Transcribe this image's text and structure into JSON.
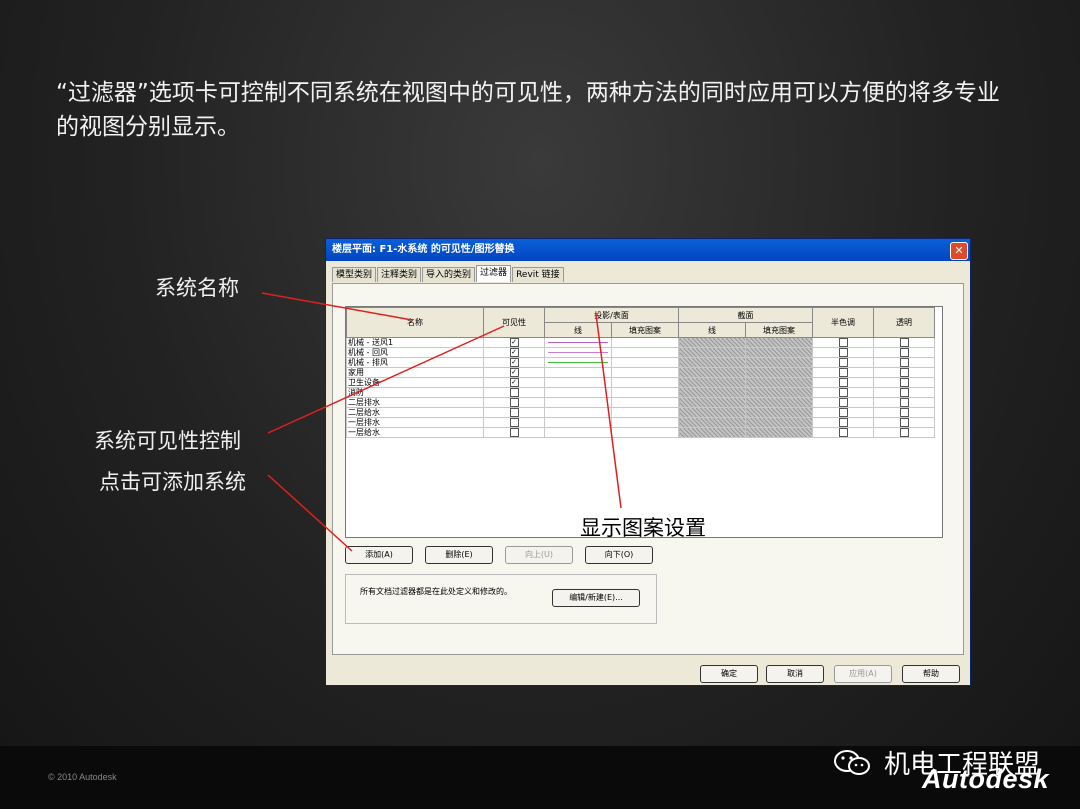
{
  "heading": "“过滤器”选项卡可控制不同系统在视图中的可见性，两种方法的同时应用可以方便的将多专业的视图分别显示。",
  "callouts": {
    "system_name": "系统名称",
    "visibility_control": "系统可见性控制",
    "add_system": "点击可添加系统",
    "pattern_setting": "显示图案设置"
  },
  "dialog": {
    "title": "楼层平面: F1-水系统 的可见性/图形替换",
    "close_label": "✕",
    "tabs": [
      "模型类别",
      "注释类别",
      "导入的类别",
      "过滤器",
      "Revit 链接"
    ],
    "active_tab": "过滤器",
    "columns": {
      "name": "名称",
      "visibility": "可见性",
      "projection": "投影/表面",
      "section": "截面",
      "lines": "线",
      "fill": "填充图案",
      "halftone": "半色调",
      "transparent": "透明"
    },
    "rows": [
      {
        "name": "机械 - 送风1",
        "visible": true,
        "line_color": "#c060c0"
      },
      {
        "name": "机械 - 回风",
        "visible": true,
        "line_color": "#c080e0"
      },
      {
        "name": "机械 - 排风",
        "visible": true,
        "line_color": "#40c040"
      },
      {
        "name": "家用",
        "visible": true,
        "line_color": ""
      },
      {
        "name": "卫生设备",
        "visible": true,
        "line_color": ""
      },
      {
        "name": "消防",
        "visible": false,
        "line_color": ""
      },
      {
        "name": "二层排水",
        "visible": false,
        "line_color": ""
      },
      {
        "name": "二层给水",
        "visible": false,
        "line_color": ""
      },
      {
        "name": "一层排水",
        "visible": false,
        "line_color": ""
      },
      {
        "name": "一层给水",
        "visible": false,
        "line_color": ""
      }
    ],
    "buttons": {
      "add": "添加(A)",
      "delete": "删除(E)",
      "up": "向上(U)",
      "down": "向下(O)",
      "edit_new": "编辑/新建(E)...",
      "ok": "确定",
      "cancel": "取消",
      "apply": "应用(A)",
      "help": "帮助"
    },
    "info_text": "所有文档过滤器都是在此处定义和修改的。"
  },
  "footer": {
    "copyright": "© 2010 Autodesk",
    "brand_cn": "机电工程联盟",
    "brand_en": "Autodesk"
  },
  "colors": {
    "callout_line": "#e02020",
    "title_bar": "#0a5fd8"
  }
}
